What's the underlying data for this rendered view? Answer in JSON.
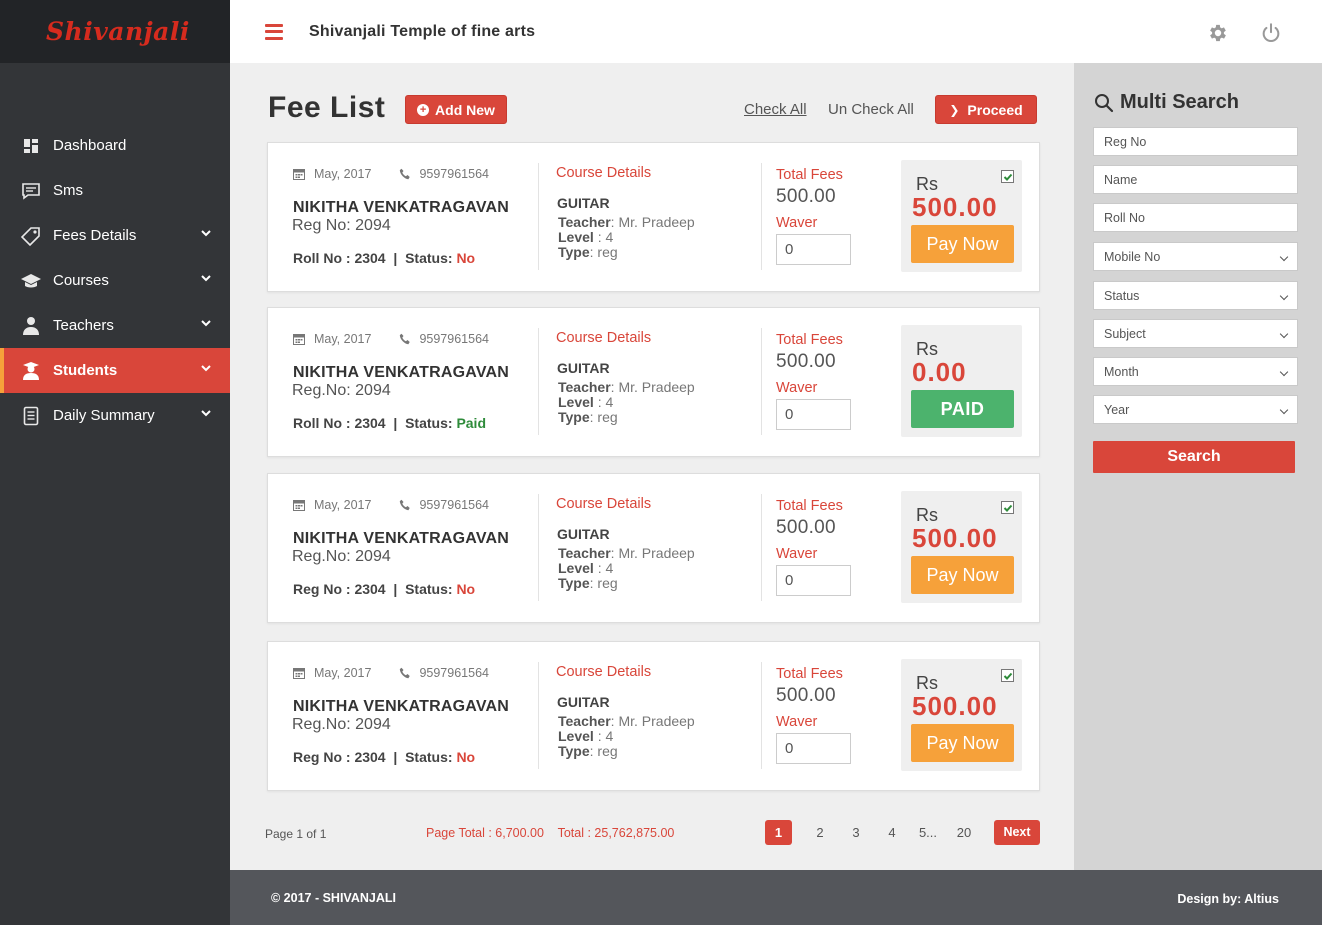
{
  "brand": {
    "logo_text": "Shivanjali",
    "app_title": "Shivanjali Temple of fine arts"
  },
  "sidebar": {
    "items": [
      {
        "label": "Dashboard",
        "icon": "dashboard-icon",
        "has_submenu": false
      },
      {
        "label": "Sms",
        "icon": "sms-icon",
        "has_submenu": false
      },
      {
        "label": "Fees Details",
        "icon": "tag-icon",
        "has_submenu": true
      },
      {
        "label": "Courses",
        "icon": "graduation-cap-icon",
        "has_submenu": true
      },
      {
        "label": "Teachers",
        "icon": "teacher-icon",
        "has_submenu": true
      },
      {
        "label": "Students",
        "icon": "student-icon",
        "has_submenu": true,
        "active": true
      },
      {
        "label": "Daily Summary",
        "icon": "document-icon",
        "has_submenu": true
      }
    ]
  },
  "main": {
    "title": "Fee List",
    "add_new_label": "Add New",
    "check_all_label": "Check All",
    "uncheck_all_label": "Un Check All",
    "proceed_label": "Proceed",
    "cards": [
      {
        "date": "May, 2017",
        "phone": "9597961564",
        "name": "NIKITHA VENKATRAGAVAN",
        "reg": "Reg No: 2094",
        "roll_label": "Roll No",
        "roll_value": "2304",
        "status_label": "Status:",
        "status": "No",
        "course_title": "Course Details",
        "subject": "GUITAR",
        "teacher_label": "Teacher",
        "teacher": "Mr. Pradeep",
        "level_label": "Level",
        "level": "4",
        "type_label": "Type",
        "type": "reg",
        "fees_label": "Total Fees",
        "fees": "500.00",
        "waver_label": "Waver",
        "waver": "0",
        "rs_label": "Rs",
        "amount": "500.00",
        "checked": true,
        "button": "Pay Now",
        "paid": false
      },
      {
        "date": "May, 2017",
        "phone": "9597961564",
        "name": "NIKITHA VENKATRAGAVAN",
        "reg": "Reg.No: 2094",
        "roll_label": "Roll No",
        "roll_value": "2304",
        "status_label": "Status:",
        "status": "Paid",
        "course_title": "Course Details",
        "subject": "GUITAR",
        "teacher_label": "Teacher",
        "teacher": "Mr. Pradeep",
        "level_label": "Level",
        "level": "4",
        "type_label": "Type",
        "type": "reg",
        "fees_label": "Total Fees",
        "fees": "500.00",
        "waver_label": "Waver",
        "waver": "0",
        "rs_label": "Rs",
        "amount": "0.00",
        "checked": false,
        "button": "PAID",
        "paid": true
      },
      {
        "date": "May, 2017",
        "phone": "9597961564",
        "name": "NIKITHA VENKATRAGAVAN",
        "reg": "Reg.No: 2094",
        "roll_label": "Reg No",
        "roll_value": "2304",
        "status_label": "Status:",
        "status": "No",
        "course_title": "Course Details",
        "subject": "GUITAR",
        "teacher_label": "Teacher",
        "teacher": "Mr. Pradeep",
        "level_label": "Level",
        "level": "4",
        "type_label": "Type",
        "type": "reg",
        "fees_label": "Total Fees",
        "fees": "500.00",
        "waver_label": "Waver",
        "waver": "0",
        "rs_label": "Rs",
        "amount": "500.00",
        "checked": true,
        "button": "Pay Now",
        "paid": false
      },
      {
        "date": "May, 2017",
        "phone": "9597961564",
        "name": "NIKITHA VENKATRAGAVAN",
        "reg": "Reg.No: 2094",
        "roll_label": "Reg No",
        "roll_value": "2304",
        "status_label": "Status:",
        "status": "No",
        "course_title": "Course Details",
        "subject": "GUITAR",
        "teacher_label": "Teacher",
        "teacher": "Mr. Pradeep",
        "level_label": "Level",
        "level": "4",
        "type_label": "Type",
        "type": "reg",
        "fees_label": "Total Fees",
        "fees": "500.00",
        "waver_label": "Waver",
        "waver": "0",
        "rs_label": "Rs",
        "amount": "500.00",
        "checked": true,
        "button": "Pay Now",
        "paid": false
      }
    ],
    "pagination": {
      "info": "Page 1 of 1",
      "page_total": "Page Total : 6,700.00",
      "total": "Total : 25,762,875.00",
      "pages": [
        "1",
        "2",
        "3",
        "4",
        "5...",
        "20"
      ],
      "current": "1",
      "next_label": "Next"
    }
  },
  "search_panel": {
    "title": "Multi Search",
    "fields": [
      {
        "label": "Reg No",
        "type": "input"
      },
      {
        "label": "Name",
        "type": "input"
      },
      {
        "label": "Roll No",
        "type": "input"
      },
      {
        "label": "Mobile No",
        "type": "select"
      },
      {
        "label": "Status",
        "type": "select"
      },
      {
        "label": "Subject",
        "type": "select"
      },
      {
        "label": "Month",
        "type": "select"
      },
      {
        "label": "Year",
        "type": "select"
      }
    ],
    "button_label": "Search"
  },
  "footer": {
    "copyright": "© 2017 - SHIVANJALI",
    "design": "Design by: Altius"
  },
  "colors": {
    "accent": "#d9463a",
    "orange": "#f6a13a",
    "green": "#4cb36d",
    "sidebar": "#333538",
    "footer": "#54565b"
  }
}
